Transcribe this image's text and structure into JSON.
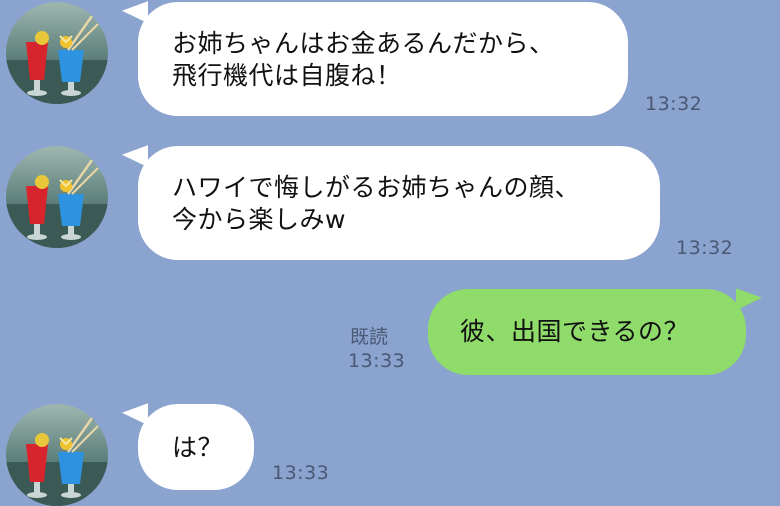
{
  "messages": [
    {
      "sender": "friend",
      "text": "お姉ちゃんはお金あるんだから、\n飛行機代は自腹ね！",
      "time": "13:32"
    },
    {
      "sender": "friend",
      "text": "ハワイで悔しがるお姉ちゃんの顔、\n今から楽しみw",
      "time": "13:32"
    },
    {
      "sender": "me",
      "text": "彼、出国できるの？",
      "read_label": "既読",
      "time": "13:33"
    },
    {
      "sender": "friend",
      "text": "は？",
      "time": "13:33"
    }
  ],
  "colors": {
    "background": "#8ba3cf",
    "incoming_bubble": "#ffffff",
    "outgoing_bubble": "#8fdc6a",
    "meta_text": "#4a5874"
  },
  "avatar_icon": "cocktail-drinks-photo"
}
